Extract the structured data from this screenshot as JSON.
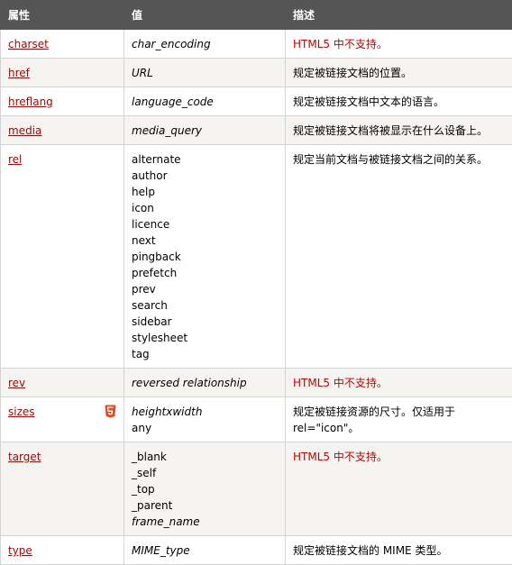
{
  "header": {
    "col_attr": "属性",
    "col_value": "值",
    "col_desc": "描述"
  },
  "rows": [
    {
      "attr": "charset",
      "values": [
        {
          "text": "char_encoding",
          "italic": true
        }
      ],
      "desc": "HTML5 中不支持。",
      "desc_red": true
    },
    {
      "attr": "href",
      "values": [
        {
          "text": "URL",
          "italic": true
        }
      ],
      "desc": "规定被链接文档的位置。",
      "desc_red": false
    },
    {
      "attr": "hreflang",
      "values": [
        {
          "text": "language_code",
          "italic": true
        }
      ],
      "desc": "规定被链接文档中文本的语言。",
      "desc_red": false
    },
    {
      "attr": "media",
      "values": [
        {
          "text": "media_query",
          "italic": true
        }
      ],
      "desc": "规定被链接文档将被显示在什么设备上。",
      "desc_red": false
    },
    {
      "attr": "rel",
      "values": [
        {
          "text": "alternate",
          "italic": false
        },
        {
          "text": "author",
          "italic": false
        },
        {
          "text": "help",
          "italic": false
        },
        {
          "text": "icon",
          "italic": false
        },
        {
          "text": "licence",
          "italic": false
        },
        {
          "text": "next",
          "italic": false
        },
        {
          "text": "pingback",
          "italic": false
        },
        {
          "text": "prefetch",
          "italic": false
        },
        {
          "text": "prev",
          "italic": false
        },
        {
          "text": "search",
          "italic": false
        },
        {
          "text": "sidebar",
          "italic": false
        },
        {
          "text": "stylesheet",
          "italic": false
        },
        {
          "text": "tag",
          "italic": false
        }
      ],
      "desc": "规定当前文档与被链接文档之间的关系。",
      "desc_red": false
    },
    {
      "attr": "rev",
      "values": [
        {
          "text": "reversed relationship",
          "italic": true
        }
      ],
      "desc": "HTML5 中不支持。",
      "desc_red": true
    },
    {
      "attr": "sizes",
      "badge": "html5-badge-icon",
      "badge_color": "#e44d26",
      "values": [
        {
          "text": "heightxwidth",
          "italic": true
        },
        {
          "text": "any",
          "italic": false
        }
      ],
      "desc": "规定被链接资源的尺寸。仅适用于 rel=\"icon\"。",
      "desc_red": false
    },
    {
      "attr": "target",
      "values": [
        {
          "text": "_blank",
          "italic": false
        },
        {
          "text": "_self",
          "italic": false
        },
        {
          "text": "_top",
          "italic": false
        },
        {
          "text": "_parent",
          "italic": false
        },
        {
          "text": "frame_name",
          "italic": true
        }
      ],
      "desc": "HTML5 中不支持。",
      "desc_red": true
    },
    {
      "attr": "type",
      "values": [
        {
          "text": "MIME_type",
          "italic": true
        }
      ],
      "desc": "规定被链接文档的 MIME 类型。",
      "desc_red": false
    }
  ],
  "colors": {
    "header_bg": "#555555",
    "link": "#900b09",
    "unsupported_text": "#c00000",
    "alt_row_bg": "#f6f4f0",
    "border": "#d4d4d4"
  }
}
